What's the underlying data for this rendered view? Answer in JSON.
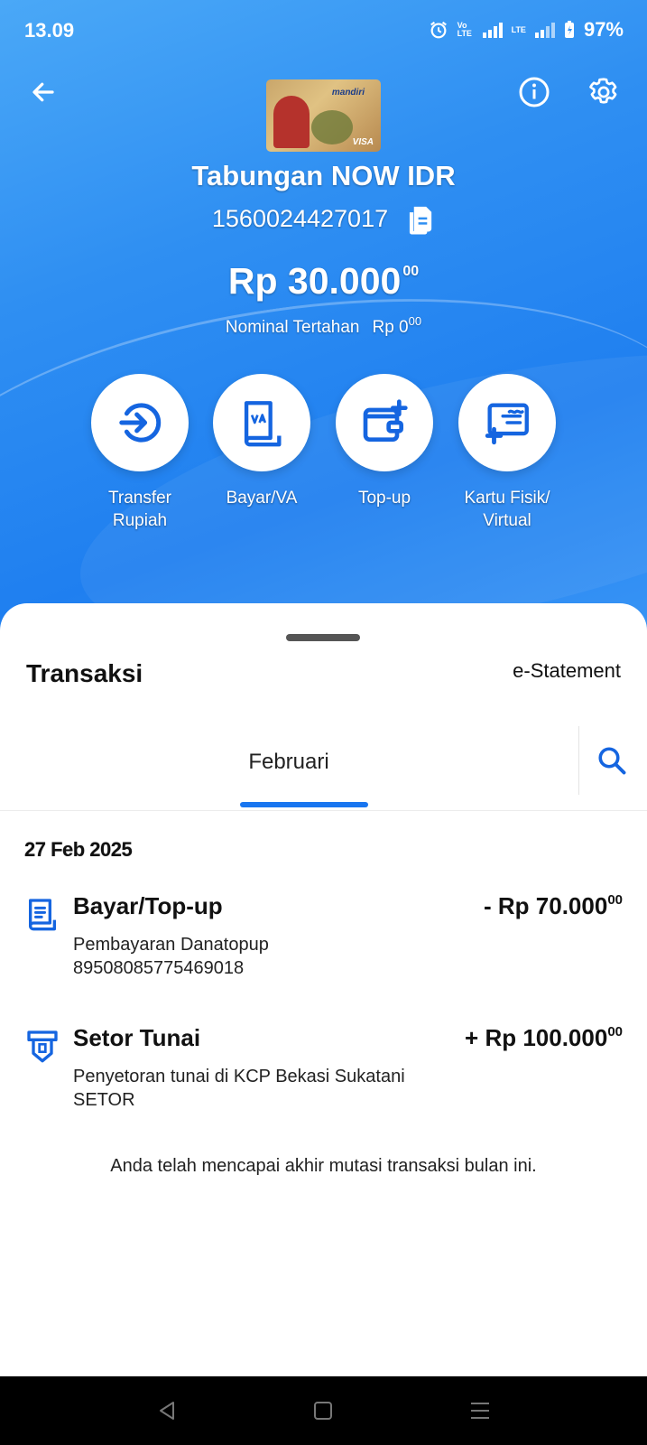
{
  "status_bar": {
    "time": "13.09",
    "network_volte": "Vo LTE",
    "network_lte": "LTE",
    "battery": "97%"
  },
  "header": {
    "card_brand": "mandiri",
    "card_network": "VISA",
    "account_name": "Tabungan NOW IDR",
    "account_number": "1560024427017",
    "balance_main": "Rp 30.000",
    "balance_cents": "00",
    "hold_label": "Nominal Tertahan",
    "hold_main": "Rp 0",
    "hold_cents": "00"
  },
  "actions": [
    {
      "label_line1": "Transfer",
      "label_line2": "Rupiah",
      "icon": "transfer-icon"
    },
    {
      "label_line1": "Bayar/VA",
      "label_line2": "",
      "icon": "va-icon"
    },
    {
      "label_line1": "Top-up",
      "label_line2": "",
      "icon": "wallet-add-icon"
    },
    {
      "label_line1": "Kartu Fisik/",
      "label_line2": "Virtual",
      "icon": "card-add-icon"
    }
  ],
  "transactions_sheet": {
    "title": "Transaksi",
    "estatement": "e-Statement",
    "month_tab": "Februari",
    "date": "27 Feb 2025",
    "items": [
      {
        "title": "Bayar/Top-up",
        "amount": "- Rp 70.000",
        "cents": "00",
        "desc1": "Pembayaran Danatopup",
        "desc2": "89508085775469018",
        "icon": "receipt-icon"
      },
      {
        "title": "Setor Tunai",
        "amount": "+ Rp 100.000",
        "cents": "00",
        "desc1": "Penyetoran tunai di KCP Bekasi Sukatani",
        "desc2": "SETOR",
        "icon": "atm-deposit-icon"
      }
    ],
    "end_note": "Anda telah mencapai akhir mutasi transaksi bulan ini."
  },
  "colors": {
    "hero_blue": "#1f7ff0",
    "accent_blue": "#1976f0",
    "icon_blue": "#1565e0"
  }
}
